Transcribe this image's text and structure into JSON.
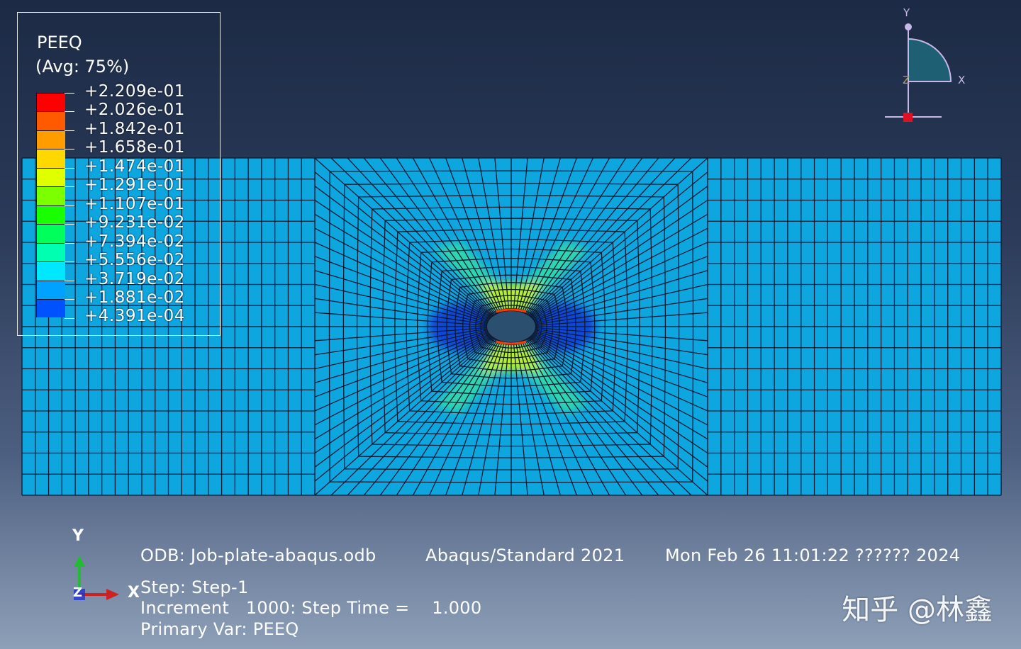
{
  "legend": {
    "title": "PEEQ",
    "subtitle": "(Avg: 75%)",
    "levels": [
      {
        "label": "+2.209e-01",
        "color": "#ff0000"
      },
      {
        "label": "+2.026e-01",
        "color": "#ff5a00"
      },
      {
        "label": "+1.842e-01",
        "color": "#ff9c00"
      },
      {
        "label": "+1.658e-01",
        "color": "#ffd800"
      },
      {
        "label": "+1.474e-01",
        "color": "#e0ff00"
      },
      {
        "label": "+1.291e-01",
        "color": "#7cff00"
      },
      {
        "label": "+1.107e-01",
        "color": "#1aff00"
      },
      {
        "label": "+9.231e-02",
        "color": "#00ff5a"
      },
      {
        "label": "+7.394e-02",
        "color": "#00ffb0"
      },
      {
        "label": "+5.556e-02",
        "color": "#00e8ff"
      },
      {
        "label": "+3.719e-02",
        "color": "#00a2ff"
      },
      {
        "label": "+1.881e-02",
        "color": "#0052ff"
      },
      {
        "label": "+4.391e-04",
        "color": "#0000ff"
      }
    ]
  },
  "triad": {
    "y_label": "Y",
    "x_label": "X",
    "z_label": "Z"
  },
  "axes": {
    "y_label": "Y",
    "x_label": "X",
    "z_label": "Z"
  },
  "info": {
    "odb": "ODB: Job-plate-abaqus.odb",
    "solver": "Abaqus/Standard 2021",
    "date": "Mon Feb 26 11:01:22 ?????? 2024",
    "step": "Step: Step-1",
    "increment": "Increment   1000: Step Time =    1.000",
    "primary_var": "Primary Var: PEEQ"
  },
  "watermark": "知乎 @林鑫",
  "colors": {
    "plate_base": "#00a2ff",
    "mesh_line": "#0d1a33",
    "hole": "#2a4f6f"
  }
}
